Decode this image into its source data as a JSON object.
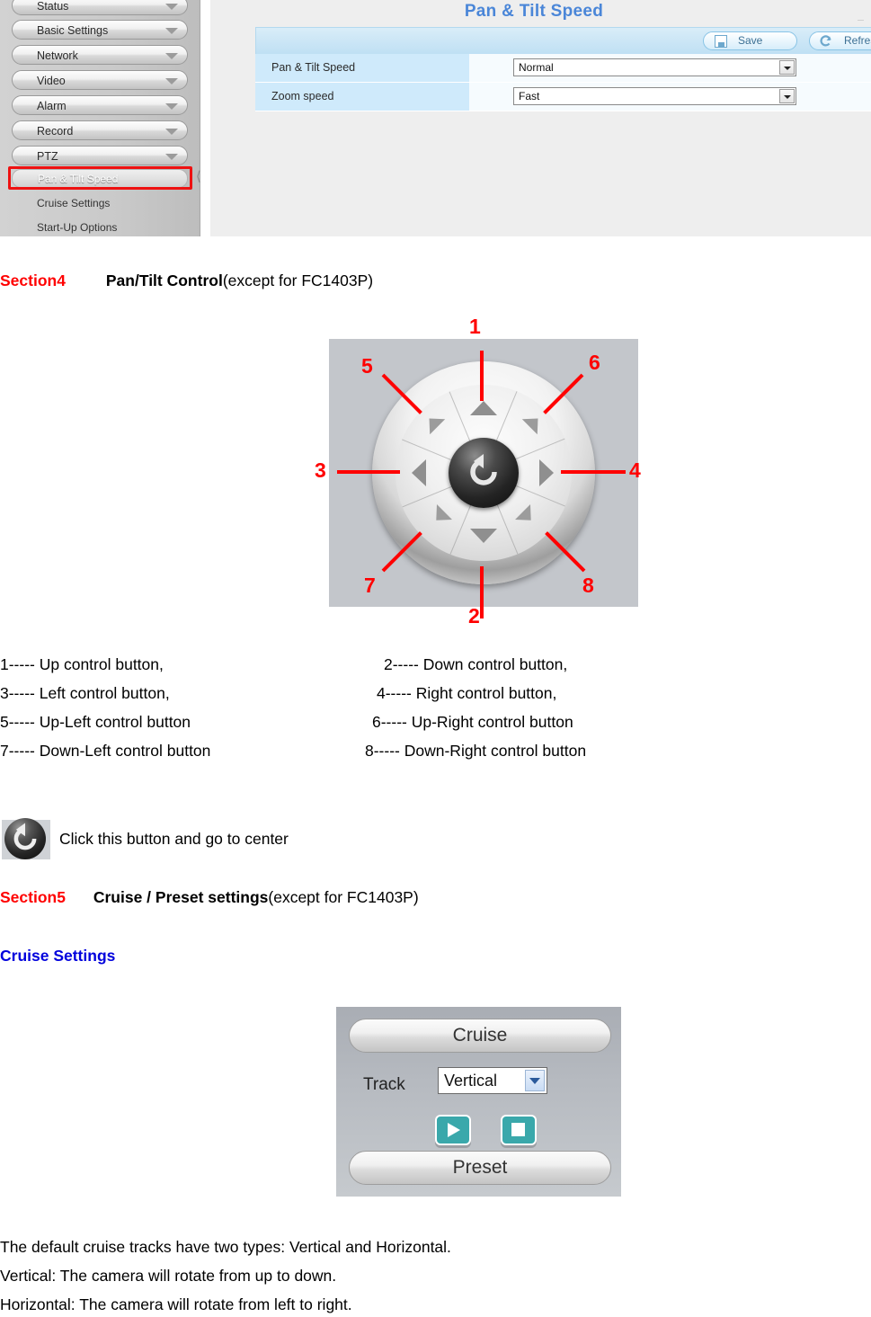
{
  "screenshot": {
    "page_title": "Pan & Tilt Speed",
    "sidebar": {
      "menu_items": [
        {
          "label": "Status",
          "icon": "chevron-down-icon"
        },
        {
          "label": "Basic Settings",
          "icon": "chevron-down-icon"
        },
        {
          "label": "Network",
          "icon": "chevron-down-icon"
        },
        {
          "label": "Video",
          "icon": "chevron-down-icon"
        },
        {
          "label": "Alarm",
          "icon": "chevron-down-icon"
        },
        {
          "label": "Record",
          "icon": "chevron-down-icon"
        },
        {
          "label": "PTZ",
          "icon": "chevron-down-icon"
        }
      ],
      "sub_items": [
        {
          "label": "Pan & Tilt Speed",
          "active": true
        },
        {
          "label": "Cruise Settings",
          "active": false
        },
        {
          "label": "Start-Up Options",
          "active": false
        }
      ]
    },
    "toolbar": {
      "save_label": "Save",
      "save_icon": "floppy-disk-icon",
      "refresh_label": "Refresh",
      "refresh_icon": "refresh-arrow-icon"
    },
    "rows": [
      {
        "label": "Pan & Tilt Speed",
        "value": "Normal"
      },
      {
        "label": "Zoom speed",
        "value": "Fast"
      }
    ],
    "accent_color": "#4a86d8",
    "row_label_bg": "#cfeafb",
    "highlight_color": "#ff0000"
  },
  "section4": {
    "number": "Section4",
    "title": "Pan/Tilt Control",
    "note": "(except for FC1403P)"
  },
  "dpad": {
    "callouts": [
      {
        "id": "1",
        "direction": "up"
      },
      {
        "id": "2",
        "direction": "down"
      },
      {
        "id": "3",
        "direction": "left"
      },
      {
        "id": "4",
        "direction": "right"
      },
      {
        "id": "5",
        "direction": "up-left"
      },
      {
        "id": "6",
        "direction": "up-right"
      },
      {
        "id": "7",
        "direction": "down-left"
      },
      {
        "id": "8",
        "direction": "down-right"
      }
    ],
    "center_icon": "rotate-counterclockwise-icon"
  },
  "legend": {
    "left_column": [
      "1----- Up control button,",
      "3----- Left control button,",
      "5----- Up-Left control button",
      "7----- Down-Left control button"
    ],
    "right_column": [
      "2----- Down control button,",
      "4----- Right control button,",
      "6----- Up-Right control button",
      "8----- Down-Right control button"
    ]
  },
  "center_button_note": {
    "icon": "rotate-counterclockwise-icon",
    "text": "Click this button and go to center"
  },
  "section5": {
    "number": "Section5",
    "title": "Cruise / Preset settings",
    "note": "(except for FC1403P)",
    "subheading": "Cruise Settings"
  },
  "cruise_panel": {
    "cruise_tab": "Cruise",
    "preset_tab": "Preset",
    "track_label": "Track",
    "track_value": "Vertical",
    "play_icon": "play-icon",
    "stop_icon": "stop-icon",
    "button_color": "#3aa8ab"
  },
  "footer_text": [
    "The default cruise tracks have two types: Vertical and Horizontal.",
    "Vertical: The camera will rotate from up to down.",
    "Horizontal: The camera will rotate from left to right."
  ]
}
